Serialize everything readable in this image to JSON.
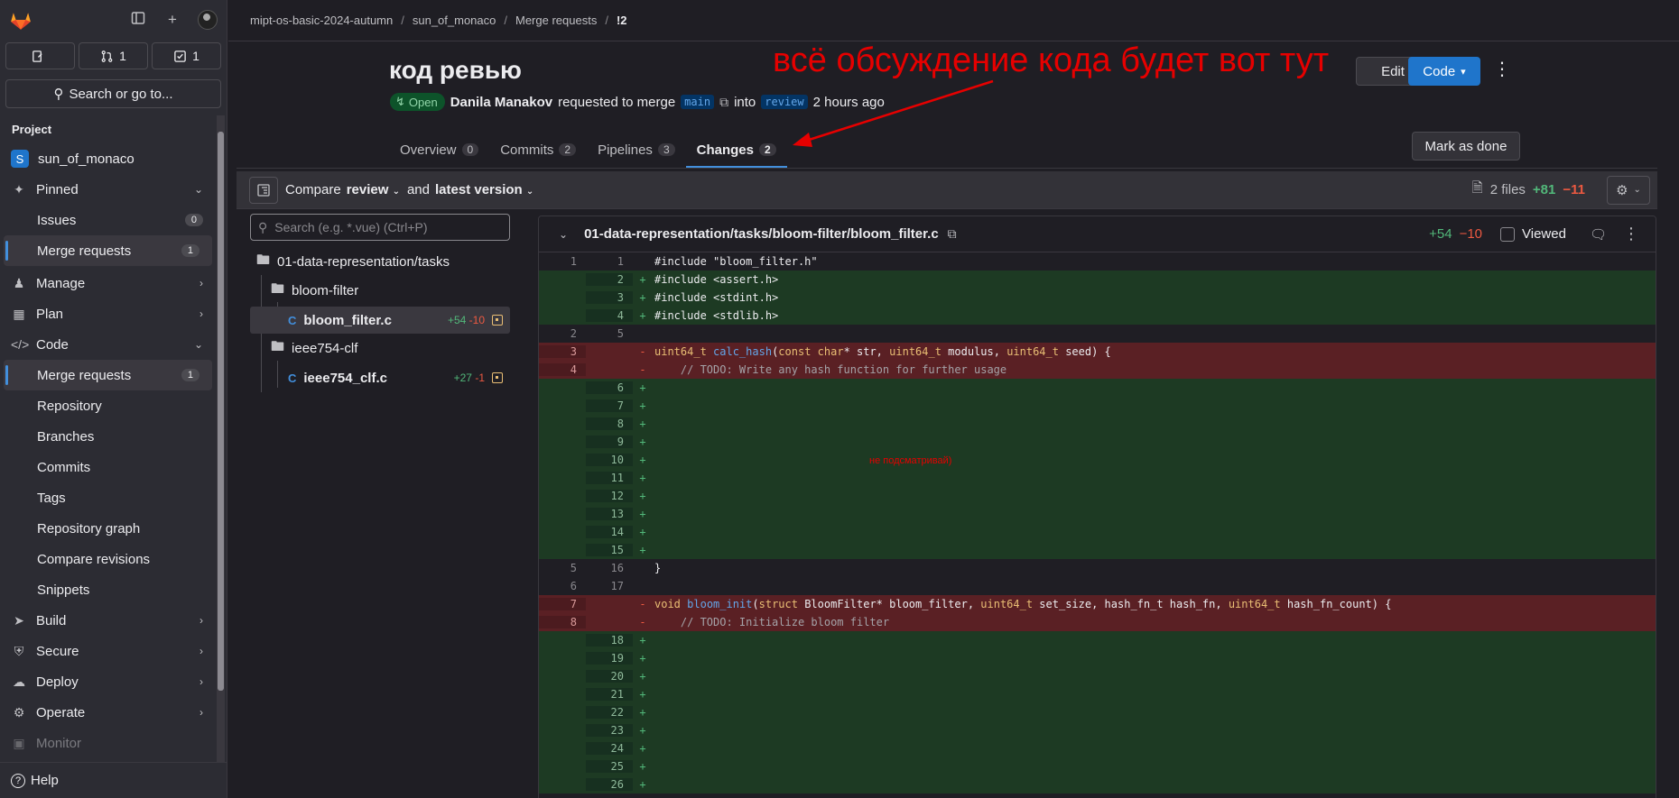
{
  "sidebar": {
    "counts": {
      "issues": "",
      "merge_requests": "1",
      "todos": "1"
    },
    "search_label": "Search or go to...",
    "section_title": "Project",
    "project_name": "sun_of_monaco",
    "project_initial": "S",
    "items": {
      "pinned": "Pinned",
      "issues": "Issues",
      "issues_count": "0",
      "merge_requests_pinned": "Merge requests",
      "merge_requests_pinned_count": "1",
      "manage": "Manage",
      "plan": "Plan",
      "code": "Code",
      "merge_requests": "Merge requests",
      "merge_requests_count": "1",
      "repository": "Repository",
      "branches": "Branches",
      "commits": "Commits",
      "tags": "Tags",
      "repository_graph": "Repository graph",
      "compare_revisions": "Compare revisions",
      "snippets": "Snippets",
      "build": "Build",
      "secure": "Secure",
      "deploy": "Deploy",
      "operate": "Operate",
      "monitor": "Monitor"
    },
    "help": "Help"
  },
  "breadcrumb": [
    "mipt-os-basic-2024-autumn",
    "sun_of_monaco",
    "Merge requests",
    "!2"
  ],
  "mr": {
    "title": "код ревью",
    "status": "Open",
    "author": "Danila Manakov",
    "requested_text": "requested to merge",
    "source_branch": "main",
    "into_text": "into",
    "target_branch": "review",
    "time": "2 hours ago",
    "edit_label": "Edit",
    "code_label": "Code",
    "mark_done_label": "Mark as done"
  },
  "annotation": "всё обсуждение кода будет вот тут",
  "tabs": [
    {
      "label": "Overview",
      "count": "0"
    },
    {
      "label": "Commits",
      "count": "2"
    },
    {
      "label": "Pipelines",
      "count": "3"
    },
    {
      "label": "Changes",
      "count": "2"
    }
  ],
  "compare": {
    "compare_text": "Compare",
    "base": "review",
    "and_text": "and",
    "head": "latest version",
    "files": "2 files",
    "additions": "+81",
    "deletions": "−11"
  },
  "tree": {
    "search_placeholder": "Search (e.g. *.vue) (Ctrl+P)",
    "root_folder": "01-data-representation/tasks",
    "folder1": "bloom-filter",
    "file1": {
      "name": "bloom_filter.c",
      "add": "+54",
      "del": "-10"
    },
    "folder2": "ieee754-clf",
    "file2": {
      "name": "ieee754_clf.c",
      "add": "+27",
      "del": "-1"
    },
    "file_icon_letter": "C"
  },
  "diff": {
    "path": "01-data-representation/tasks/bloom-filter/bloom_filter.c",
    "additions": "+54",
    "deletions": "−10",
    "viewed_label": "Viewed",
    "peek_note": "не подсматривай)",
    "lines": [
      {
        "type": "ctx",
        "old": "1",
        "new": "1",
        "code": "#include \"bloom_filter.h\""
      },
      {
        "type": "add",
        "old": "",
        "new": "2",
        "code": "#include <assert.h>"
      },
      {
        "type": "add",
        "old": "",
        "new": "3",
        "code": "#include <stdint.h>"
      },
      {
        "type": "add",
        "old": "",
        "new": "4",
        "code": "#include <stdlib.h>"
      },
      {
        "type": "ctx",
        "old": "2",
        "new": "5",
        "code": ""
      },
      {
        "type": "del",
        "old": "3",
        "new": "",
        "code": "uint64_t calc_hash(const char* str, uint64_t modulus, uint64_t seed) {"
      },
      {
        "type": "del",
        "old": "4",
        "new": "",
        "code": "    // TODO: Write any hash function for further usage"
      },
      {
        "type": "add",
        "old": "",
        "new": "6",
        "code": ""
      },
      {
        "type": "add",
        "old": "",
        "new": "7",
        "code": ""
      },
      {
        "type": "add",
        "old": "",
        "new": "8",
        "code": ""
      },
      {
        "type": "add",
        "old": "",
        "new": "9",
        "code": ""
      },
      {
        "type": "add",
        "old": "",
        "new": "10",
        "code": ""
      },
      {
        "type": "add",
        "old": "",
        "new": "11",
        "code": ""
      },
      {
        "type": "add",
        "old": "",
        "new": "12",
        "code": ""
      },
      {
        "type": "add",
        "old": "",
        "new": "13",
        "code": ""
      },
      {
        "type": "add",
        "old": "",
        "new": "14",
        "code": ""
      },
      {
        "type": "add",
        "old": "",
        "new": "15",
        "code": ""
      },
      {
        "type": "ctx",
        "old": "5",
        "new": "16",
        "code": "}"
      },
      {
        "type": "ctx",
        "old": "6",
        "new": "17",
        "code": ""
      },
      {
        "type": "del",
        "old": "7",
        "new": "",
        "code": "void bloom_init(struct BloomFilter* bloom_filter, uint64_t set_size, hash_fn_t hash_fn, uint64_t hash_fn_count) {"
      },
      {
        "type": "del",
        "old": "8",
        "new": "",
        "code": "    // TODO: Initialize bloom filter"
      },
      {
        "type": "add",
        "old": "",
        "new": "18",
        "code": ""
      },
      {
        "type": "add",
        "old": "",
        "new": "19",
        "code": ""
      },
      {
        "type": "add",
        "old": "",
        "new": "20",
        "code": ""
      },
      {
        "type": "add",
        "old": "",
        "new": "21",
        "code": ""
      },
      {
        "type": "add",
        "old": "",
        "new": "22",
        "code": ""
      },
      {
        "type": "add",
        "old": "",
        "new": "23",
        "code": ""
      },
      {
        "type": "add",
        "old": "",
        "new": "24",
        "code": ""
      },
      {
        "type": "add",
        "old": "",
        "new": "25",
        "code": ""
      },
      {
        "type": "add",
        "old": "",
        "new": "26",
        "code": ""
      }
    ]
  },
  "colors": {
    "accent": "#1f75cb",
    "annotation": "#e60000",
    "add_bg": "#1d3a23",
    "del_bg": "#5a2024"
  }
}
